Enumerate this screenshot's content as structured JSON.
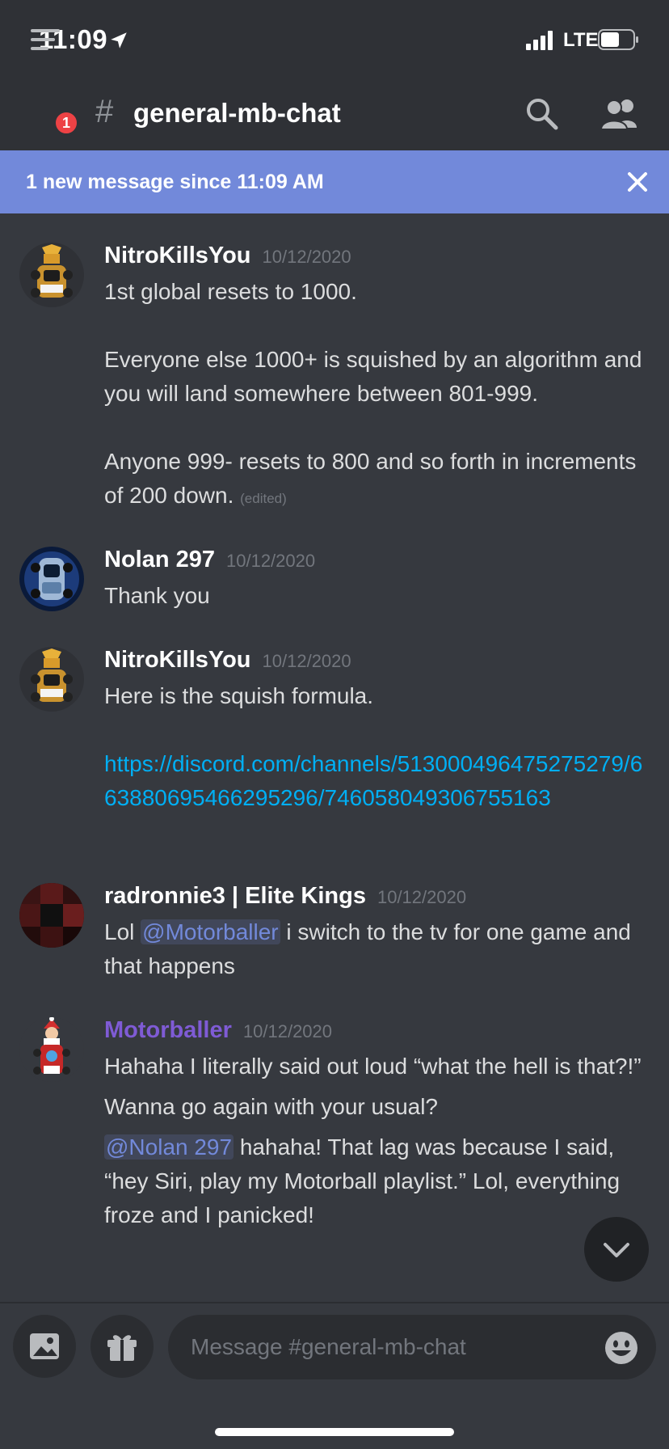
{
  "status_bar": {
    "time": "11:09",
    "network": "LTE"
  },
  "header": {
    "channel_name": "general-mb-chat",
    "unread_badge": "1"
  },
  "banner": {
    "text": "1 new message since 11:09 AM"
  },
  "messages": [
    {
      "author": "NitroKillsYou",
      "timestamp": "10/12/2020",
      "lines": [
        "1st global resets to 1000.",
        "Everyone else 1000+ is squished by an algorithm and you will land somewhere between 801-999.",
        "Anyone 999- resets to 800 and so forth in increments of 200 down."
      ],
      "edited_label": "(edited)"
    },
    {
      "author": "Nolan 297",
      "timestamp": "10/12/2020",
      "lines": [
        "Thank you"
      ]
    },
    {
      "author": "NitroKillsYou",
      "timestamp": "10/12/2020",
      "lines": [
        "Here is the squish formula."
      ],
      "link": "https://discord.com/channels/513000496475275279/663880695466295296/746058049306755163"
    },
    {
      "author": "radronnie3 | Elite Kings",
      "timestamp": "10/12/2020",
      "before_mention": "Lol ",
      "mention": "@Motorballer",
      "after_mention": " i switch to the tv for one game and that happens"
    },
    {
      "author": "Motorballer",
      "timestamp": "10/12/2020",
      "line1": "Hahaha I literally said out loud “what the hell is that?!”",
      "line2": "Wanna go again with your usual?",
      "mention": "@Nolan 297",
      "after_mention": " hahaha! That lag was because I said, “hey Siri, play my Motorball playlist.”  Lol, everything froze and I panicked!"
    }
  ],
  "composer": {
    "placeholder": "Message #general-mb-chat"
  },
  "colors": {
    "accent": "#7289da",
    "link": "#00aff4",
    "moderator_name": "#7f5bd5",
    "badge": "#ed4245"
  },
  "icons": [
    "location-arrow-icon",
    "signal-icon",
    "battery-icon",
    "hamburger-menu-icon",
    "hash-icon",
    "search-icon",
    "members-icon",
    "close-icon",
    "chevron-down-icon",
    "image-icon",
    "gift-icon",
    "emoji-icon"
  ]
}
